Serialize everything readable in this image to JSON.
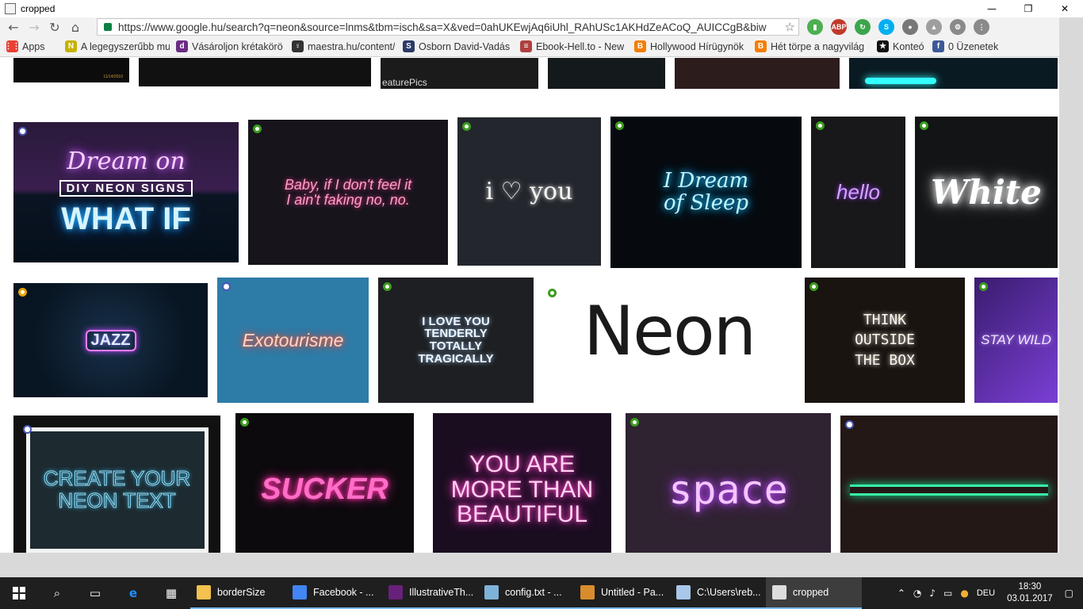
{
  "window": {
    "title": "cropped",
    "minimize": "—",
    "restore": "❐",
    "close": "✕"
  },
  "browser": {
    "url": "https://www.google.hu/search?q=neon&source=lnms&tbm=isch&sa=X&ved=0ahUKEwjAq6iUhl_RAhUSc1AKHdZeACoQ_AUICCgB&biw",
    "bookmarks": [
      {
        "label": "Apps",
        "icon": "apps-grid-icon",
        "color": "#e94235"
      },
      {
        "label": "A legegyszerűbb mu",
        "icon": "n-icon",
        "color": "#c7b100",
        "glyph": "N"
      },
      {
        "label": "Vásároljon krétakörö",
        "icon": "d-icon",
        "color": "#6a2c83",
        "glyph": "d"
      },
      {
        "label": "maestra.hu/content/",
        "icon": "bulb-icon",
        "color": "#333333",
        "glyph": "♀"
      },
      {
        "label": "Osborn David-Vadás",
        "icon": "s-icon",
        "color": "#2b3a67",
        "glyph": "S"
      },
      {
        "label": "Ebook-Hell.to - New",
        "icon": "book-icon",
        "color": "#b04040",
        "glyph": "≡"
      },
      {
        "label": "Hollywood Hírügynök",
        "icon": "blogger-icon",
        "color": "#f57d00",
        "glyph": "B"
      },
      {
        "label": "Hét törpe a nagyvilág",
        "icon": "blogger-icon",
        "color": "#f57d00",
        "glyph": "B"
      },
      {
        "label": "Konteó",
        "icon": "konteo-icon",
        "color": "#111111",
        "glyph": "★"
      },
      {
        "label": "0 Üzenetek",
        "icon": "facebook-icon",
        "color": "#3b5998",
        "glyph": "f"
      }
    ],
    "extensions": [
      {
        "name": "pushbullet-icon",
        "color": "#4caf50",
        "glyph": "▮"
      },
      {
        "name": "adblock-icon",
        "color": "#c0392b",
        "glyph": "ABP"
      },
      {
        "name": "refresh-ext-icon",
        "color": "#3aa64c",
        "glyph": "↻"
      },
      {
        "name": "skype-icon",
        "color": "#00aff0",
        "glyph": "S"
      },
      {
        "name": "bulb-ext-icon",
        "color": "#777777",
        "glyph": "●"
      },
      {
        "name": "drive-ext-icon",
        "color": "#9e9e9e",
        "glyph": "▲"
      },
      {
        "name": "gear-ext-icon",
        "color": "#8a8a8a",
        "glyph": "⚙"
      },
      {
        "name": "menu-ext-icon",
        "color": "#8a8a8a",
        "glyph": "⋮"
      }
    ]
  },
  "images": {
    "row0": [
      "11/14/2010",
      "",
      "eaturePics",
      "",
      "",
      ""
    ],
    "t1": {
      "line1": "Dream on",
      "line2": "DIY NEON SIGNS",
      "line3": "WHAT IF"
    },
    "t2": "Baby, if I don't feel it\nI ain't faking no, no.",
    "t3": "i ♡ you",
    "t4": "I Dream\nof Sleep",
    "t5": "hello",
    "t6": "White",
    "t7": "JAZZ",
    "t8": "Exotourisme",
    "t9": "I LOVE YOU\nTENDERLY\nTOTALLY\nTRAGICALLY",
    "t10": "Neon",
    "t11": "THINK\nOUTSIDE\nTHE BOX",
    "t12": "STAY WILD",
    "t13": "CREATE YOUR\nNEON TEXT",
    "t14": "SUCKER",
    "t15": "YOU ARE\nMORE THAN\nBEAUTIFUL",
    "t16": "space",
    "t17": ""
  },
  "taskbar": {
    "apps": [
      {
        "label": "borderSize",
        "icon": "folder-icon",
        "color": "#f2c14e"
      },
      {
        "label": "Facebook - ...",
        "icon": "chrome-icon",
        "color": "#4285f4"
      },
      {
        "label": "IllustrativeTh...",
        "icon": "visual-studio-icon",
        "color": "#68217a"
      },
      {
        "label": "config.txt - ...",
        "icon": "notepad-icon",
        "color": "#7fb2d8"
      },
      {
        "label": "Untitled - Pa...",
        "icon": "paint-icon",
        "color": "#d98c2b"
      },
      {
        "label": "C:\\Users\\reb...",
        "icon": "explorer-window-icon",
        "color": "#a9c7e8"
      },
      {
        "label": "cropped",
        "icon": "image-viewer-icon",
        "color": "#dcdcdc",
        "active": true
      }
    ],
    "tray": {
      "lang": "DEU",
      "time": "18:30",
      "date": "03.01.2017"
    }
  }
}
